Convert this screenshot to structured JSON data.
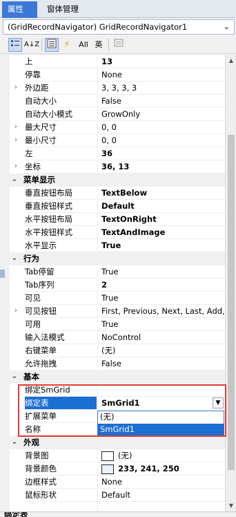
{
  "tabs": [
    {
      "label": "属性"
    },
    {
      "label": "窗体管理"
    }
  ],
  "object_selector": {
    "value": "(GridRecordNavigator) GridRecordNavigator1"
  },
  "toolbar": {
    "categorized_icon": "categorized-icon",
    "alphabetical_label": "A↓Z",
    "all_label": "All",
    "english_label": "英"
  },
  "rows": [
    {
      "name": "上",
      "value": "13",
      "bold": true
    },
    {
      "name": "停靠",
      "value": "None"
    },
    {
      "name": "外边距",
      "value": "3, 3, 3, 3",
      "expandable": true
    },
    {
      "name": "自动大小",
      "value": "False"
    },
    {
      "name": "自动大小模式",
      "value": "GrowOnly"
    },
    {
      "name": "最大尺寸",
      "value": "0, 0",
      "expandable": true
    },
    {
      "name": "最小尺寸",
      "value": "0, 0",
      "expandable": true
    },
    {
      "name": "左",
      "value": "36",
      "bold": true
    },
    {
      "name": "坐标",
      "value": "36, 13",
      "bold": true,
      "expandable": true
    }
  ],
  "cat_menu": {
    "label": "菜单显示"
  },
  "menu_rows": [
    {
      "name": "垂直按钮布局",
      "value": "TextBelow"
    },
    {
      "name": "垂直按钮样式",
      "value": "Default"
    },
    {
      "name": "水平按钮布局",
      "value": "TextOnRight"
    },
    {
      "name": "水平按钮样式",
      "value": "TextAndImage"
    },
    {
      "name": "水平显示",
      "value": "True"
    }
  ],
  "cat_behavior": {
    "label": "行为"
  },
  "behavior_rows": [
    {
      "name": "Tab停留",
      "value": "True"
    },
    {
      "name": "Tab序列",
      "value": "2"
    },
    {
      "name": "可见",
      "value": "True"
    },
    {
      "name": "可见按钮",
      "value": "First, Previous, Next, Last, Add,"
    },
    {
      "name": "可用",
      "value": "True"
    },
    {
      "name": "输入法模式",
      "value": "NoControl"
    },
    {
      "name": "右键菜单",
      "value": "(无)"
    },
    {
      "name": "允许拖拽",
      "value": "False"
    }
  ],
  "cat_basic": {
    "label": "基本"
  },
  "basic_rows": [
    {
      "name": "绑定SmGrid",
      "value": ""
    },
    {
      "name": "绑定表",
      "value": "SmGrid1"
    },
    {
      "name": "扩展菜单",
      "value": ""
    },
    {
      "name": "名称",
      "value": ""
    }
  ],
  "dropdown": {
    "options": [
      "(无)",
      "SmGrid1"
    ],
    "selected": "SmGrid1"
  },
  "cat_appearance": {
    "label": "外观"
  },
  "appearance_rows": [
    {
      "name": "背景图",
      "value": "(无)",
      "swatch": "#ffffff"
    },
    {
      "name": "背景颜色",
      "value": "233, 241, 250",
      "swatch": "#e9f1fa"
    },
    {
      "name": "边框样式",
      "value": "None"
    },
    {
      "name": "鼠标形状",
      "value": "Default"
    }
  ],
  "description": {
    "title": "绑定表"
  },
  "colors": {
    "accent": "#1b6ed2",
    "highlight_box": "#e53935",
    "tab_active": "#3c78d8"
  }
}
